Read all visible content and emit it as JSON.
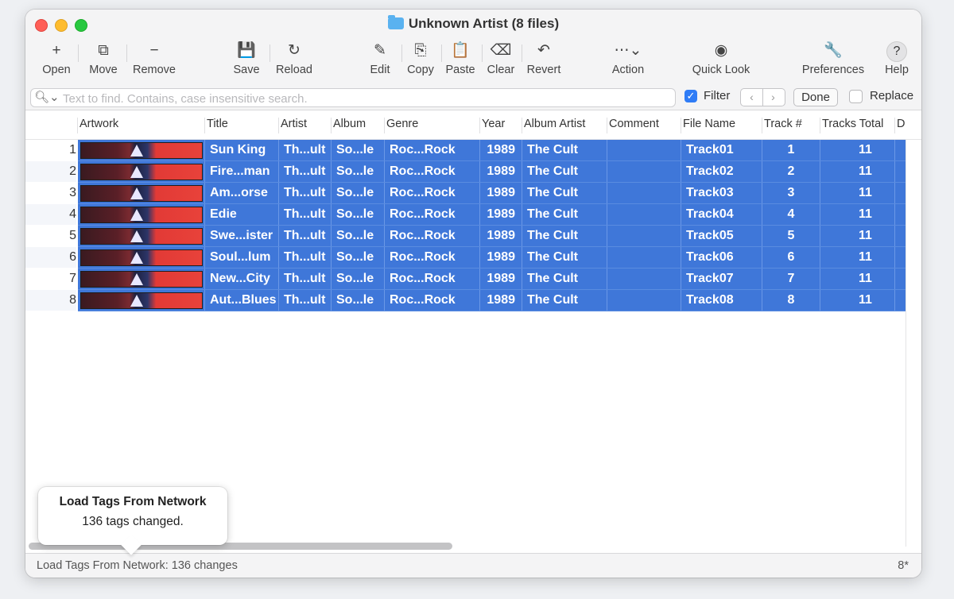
{
  "window": {
    "title": "Unknown Artist (8 files)"
  },
  "toolbar": {
    "open": "Open",
    "move": "Move",
    "remove": "Remove",
    "save": "Save",
    "reload": "Reload",
    "edit": "Edit",
    "copy": "Copy",
    "paste": "Paste",
    "clear": "Clear",
    "revert": "Revert",
    "action": "Action",
    "quick_look": "Quick Look",
    "preferences": "Preferences",
    "help": "Help"
  },
  "search": {
    "placeholder": "Text to find. Contains, case insensitive search.",
    "filter_label": "Filter",
    "filter_checked": true,
    "done_label": "Done",
    "replace_label": "Replace",
    "replace_checked": false
  },
  "columns": [
    "Artwork",
    "Title",
    "Artist",
    "Album",
    "Genre",
    "Year",
    "Album Artist",
    "Comment",
    "File Name",
    "Track #",
    "Tracks Total",
    "D"
  ],
  "rows": [
    {
      "num": "1",
      "title": "Sun King",
      "artist": "Th...ult",
      "album": "So...le",
      "genre": "Roc...Rock",
      "year": "1989",
      "album_artist": "The Cult",
      "comment": "",
      "file_name": "Track01",
      "track": "1",
      "total": "11"
    },
    {
      "num": "2",
      "title": "Fire...man",
      "artist": "Th...ult",
      "album": "So...le",
      "genre": "Roc...Rock",
      "year": "1989",
      "album_artist": "The Cult",
      "comment": "",
      "file_name": "Track02",
      "track": "2",
      "total": "11"
    },
    {
      "num": "3",
      "title": "Am...orse",
      "artist": "Th...ult",
      "album": "So...le",
      "genre": "Roc...Rock",
      "year": "1989",
      "album_artist": "The Cult",
      "comment": "",
      "file_name": "Track03",
      "track": "3",
      "total": "11"
    },
    {
      "num": "4",
      "title": "Edie",
      "artist": "Th...ult",
      "album": "So...le",
      "genre": "Roc...Rock",
      "year": "1989",
      "album_artist": "The Cult",
      "comment": "",
      "file_name": "Track04",
      "track": "4",
      "total": "11"
    },
    {
      "num": "5",
      "title": "Swe...ister",
      "artist": "Th...ult",
      "album": "So...le",
      "genre": "Roc...Rock",
      "year": "1989",
      "album_artist": "The Cult",
      "comment": "",
      "file_name": "Track05",
      "track": "5",
      "total": "11"
    },
    {
      "num": "6",
      "title": "Soul...lum",
      "artist": "Th...ult",
      "album": "So...le",
      "genre": "Roc...Rock",
      "year": "1989",
      "album_artist": "The Cult",
      "comment": "",
      "file_name": "Track06",
      "track": "6",
      "total": "11"
    },
    {
      "num": "7",
      "title": "New...City",
      "artist": "Th...ult",
      "album": "So...le",
      "genre": "Roc...Rock",
      "year": "1989",
      "album_artist": "The Cult",
      "comment": "",
      "file_name": "Track07",
      "track": "7",
      "total": "11"
    },
    {
      "num": "8",
      "title": "Aut...Blues",
      "artist": "Th...ult",
      "album": "So...le",
      "genre": "Roc...Rock",
      "year": "1989",
      "album_artist": "The Cult",
      "comment": "",
      "file_name": "Track08",
      "track": "8",
      "total": "11"
    }
  ],
  "popover": {
    "title": "Load Tags From Network",
    "message": "136 tags changed."
  },
  "status": {
    "text": "Load Tags From Network: 136 changes",
    "count": "8*"
  },
  "colors": {
    "selection": "#3f77d9",
    "accent": "#2f7cf6"
  }
}
